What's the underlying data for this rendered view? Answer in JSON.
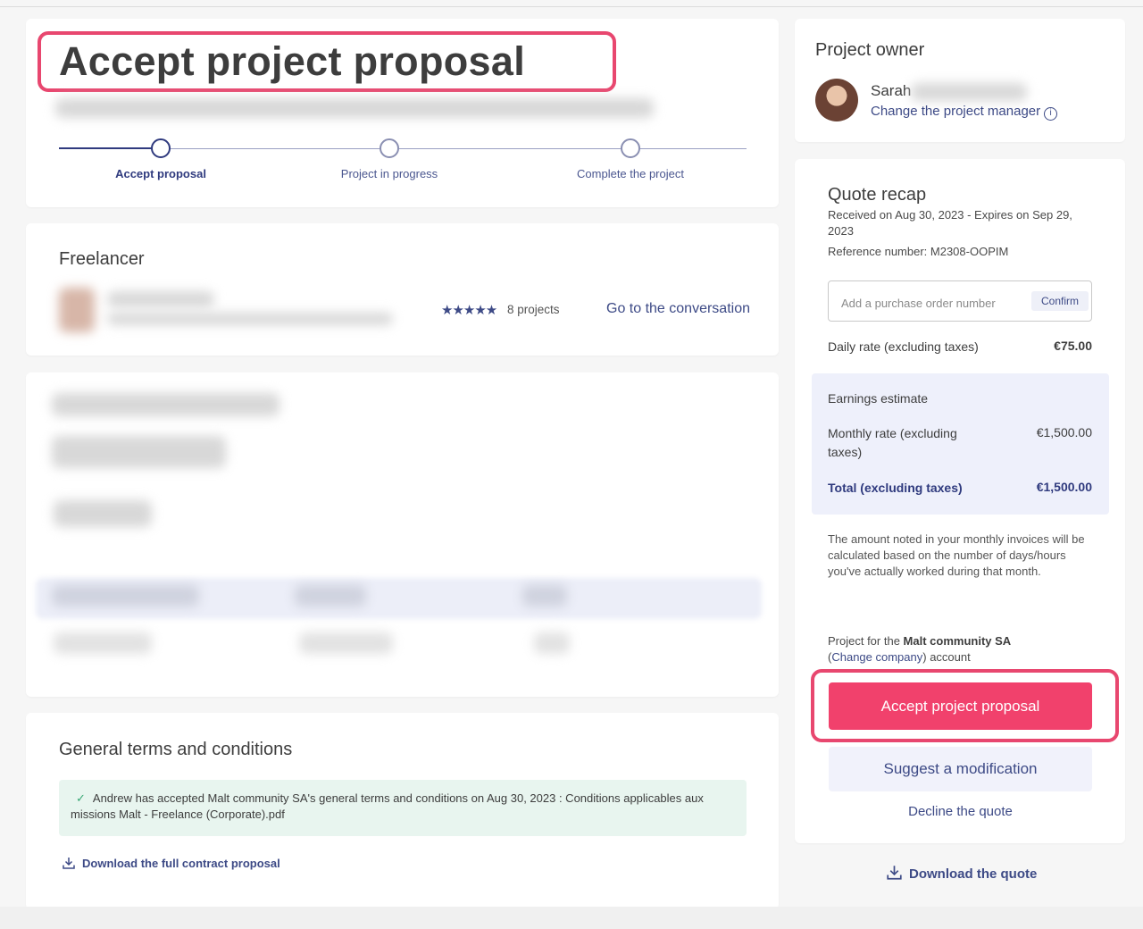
{
  "header": {
    "title": "Accept project proposal",
    "steps": [
      {
        "label": "Accept proposal"
      },
      {
        "label": "Project in progress"
      },
      {
        "label": "Complete the project"
      }
    ]
  },
  "freelancer": {
    "section_title": "Freelancer",
    "stars": "★★★★★",
    "projects": "8 projects",
    "conversation_link": "Go to the conversation"
  },
  "terms": {
    "section_title": "General terms and conditions",
    "check": "✓",
    "accepted_text": "Andrew has accepted Malt community SA's general terms and conditions on Aug 30, 2023 : Conditions applicables aux missions Malt - Freelance (Corporate).pdf",
    "download_contract": "Download the full contract proposal"
  },
  "owner": {
    "section_title": "Project owner",
    "name": "Sarah",
    "change_manager": "Change the project manager",
    "info_glyph": "i"
  },
  "quote": {
    "title": "Quote recap",
    "received": "Received on Aug 30, 2023 - Expires on Sep 29, 2023",
    "reference": "Reference number: M2308-OOPIM",
    "po_placeholder": "Add a purchase order number",
    "po_confirm": "Confirm",
    "daily_rate_label": "Daily rate (excluding taxes)",
    "daily_rate_value": "€75.00",
    "estimate_title": "Earnings estimate",
    "monthly_label": "Monthly rate (excluding taxes)",
    "monthly_value": "€1,500.00",
    "total_label": "Total (excluding taxes)",
    "total_value": "€1,500.00",
    "note": "The amount noted in your monthly invoices will be calculated based on the number of days/hours you've actually worked during that month.",
    "company_prefix": "Project for the ",
    "company_name": "Malt community SA",
    "change_company": "Change company",
    "company_suffix": ") account",
    "paren_open": "(",
    "accept_button": "Accept project proposal",
    "suggest_button": "Suggest a modification",
    "decline_link": "Decline the quote",
    "download_quote": "Download the quote"
  },
  "colors": {
    "accent": "#f1416c",
    "highlight": "#e8476f",
    "brand_blue": "#3d4a86",
    "success": "#3aa876"
  }
}
